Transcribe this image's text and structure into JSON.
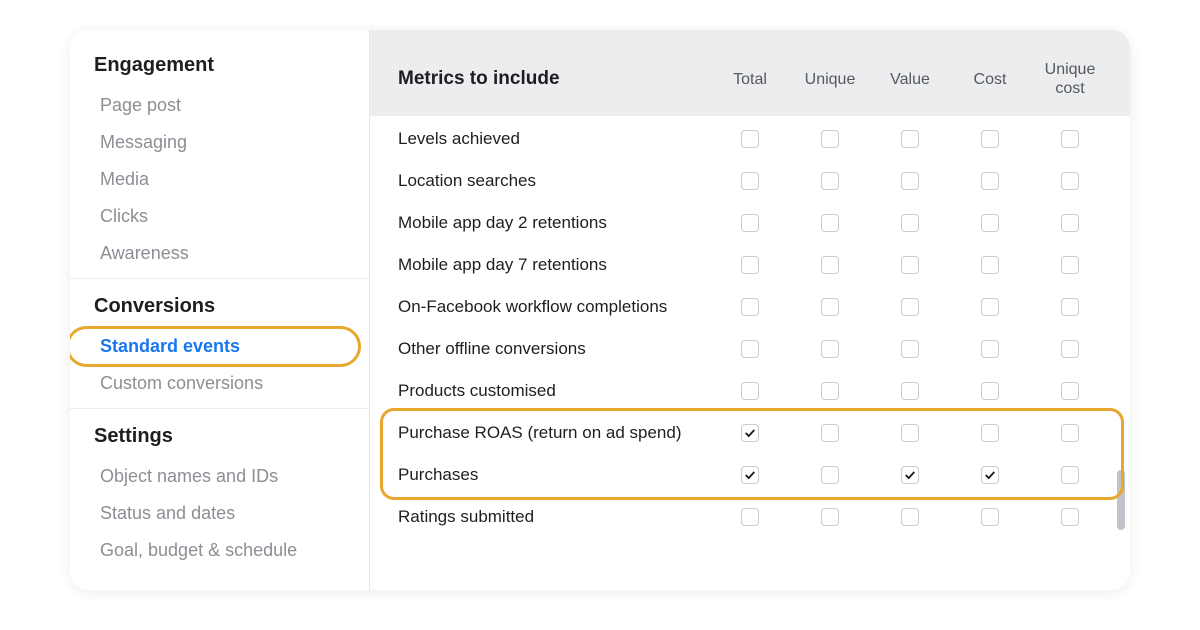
{
  "sidebar": {
    "groups": [
      {
        "title": "Engagement",
        "items": [
          {
            "label": "Page post"
          },
          {
            "label": "Messaging"
          },
          {
            "label": "Media"
          },
          {
            "label": "Clicks"
          },
          {
            "label": "Awareness"
          }
        ]
      },
      {
        "title": "Conversions",
        "items": [
          {
            "label": "Standard events",
            "active": true,
            "highlighted": true
          },
          {
            "label": "Custom conversions"
          }
        ]
      },
      {
        "title": "Settings",
        "items": [
          {
            "label": "Object names and IDs"
          },
          {
            "label": "Status and dates"
          },
          {
            "label": "Goal, budget & schedule"
          }
        ]
      }
    ]
  },
  "table": {
    "header_label": "Metrics to include",
    "columns": [
      "Total",
      "Unique",
      "Value",
      "Cost",
      "Unique cost"
    ],
    "highlighted_rows": [
      7,
      8
    ],
    "rows": [
      {
        "label": "Levels achieved",
        "checks": [
          false,
          false,
          false,
          false,
          false
        ]
      },
      {
        "label": "Location searches",
        "checks": [
          false,
          false,
          false,
          false,
          false
        ]
      },
      {
        "label": "Mobile app day 2 retentions",
        "checks": [
          false,
          false,
          false,
          false,
          false
        ]
      },
      {
        "label": "Mobile app day 7 retentions",
        "checks": [
          false,
          false,
          false,
          false,
          false
        ]
      },
      {
        "label": "On-Facebook workflow completions",
        "checks": [
          false,
          false,
          false,
          false,
          false
        ]
      },
      {
        "label": "Other offline conversions",
        "checks": [
          false,
          false,
          false,
          false,
          false
        ]
      },
      {
        "label": "Products customised",
        "checks": [
          false,
          false,
          false,
          false,
          false
        ]
      },
      {
        "label": "Purchase ROAS (return on ad spend)",
        "checks": [
          true,
          false,
          false,
          false,
          false
        ]
      },
      {
        "label": "Purchases",
        "checks": [
          true,
          false,
          true,
          true,
          false
        ]
      },
      {
        "label": "Ratings submitted",
        "checks": [
          false,
          false,
          false,
          false,
          false
        ]
      }
    ]
  },
  "colors": {
    "highlight": "#e8a72e",
    "link": "#1877f2"
  }
}
